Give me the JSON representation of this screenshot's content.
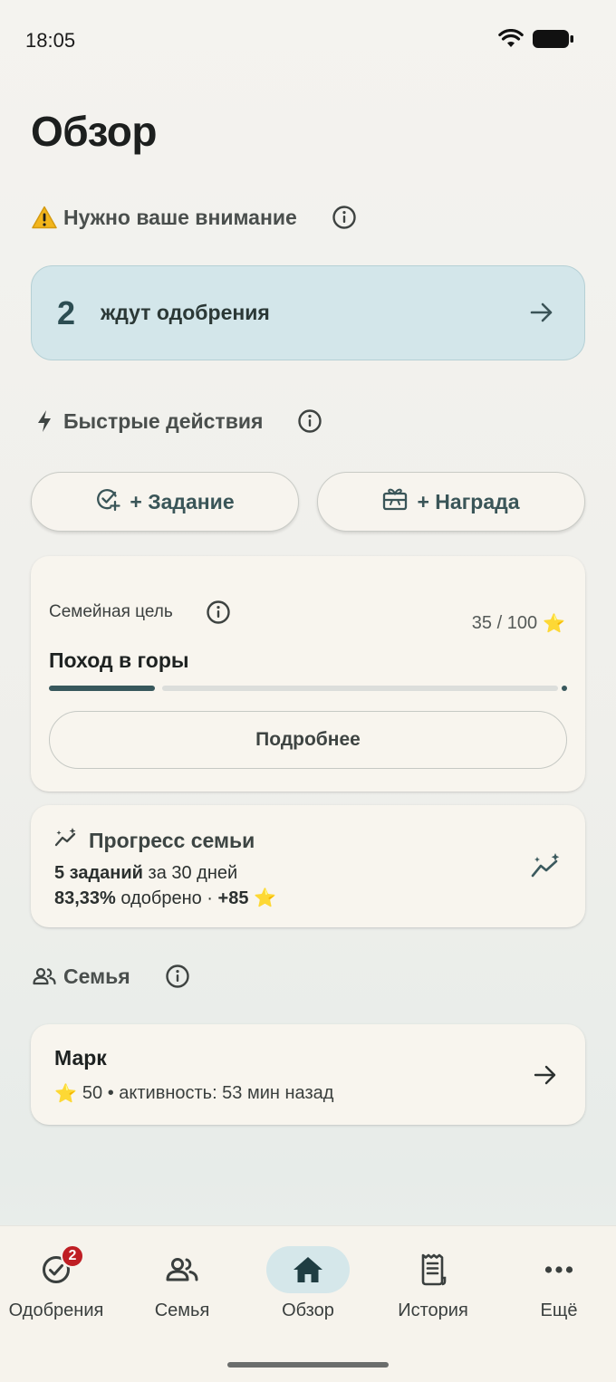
{
  "status_bar": {
    "time": "18:05"
  },
  "page": {
    "title": "Обзор"
  },
  "attention": {
    "title": "Нужно ваше внимание",
    "pending_count": "2",
    "pending_label": "ждут одобрения"
  },
  "quick_actions": {
    "title": "Быстрые действия",
    "add_task": "+ Задание",
    "add_reward": "+ Награда"
  },
  "goal": {
    "label": "Семейная цель",
    "stars": "35 / 100",
    "star_emoji": "⭐",
    "name": "Поход в горы",
    "progress": 0.35,
    "details_button": "Подробнее"
  },
  "family_progress": {
    "title": "Прогресс семьи",
    "tasks_count": "5 заданий",
    "tasks_period": " за 30 дней",
    "approved_pct": "83,33%",
    "approved_text": " одобрено · ",
    "stars_gain": "+85",
    "star_emoji": "⭐"
  },
  "family": {
    "title": "Семья",
    "members": [
      {
        "name": "Марк",
        "star_emoji": "⭐",
        "meta": "50 • активность: 53 мин назад"
      }
    ]
  },
  "nav": {
    "items": [
      {
        "label": "Одобрения",
        "badge": "2"
      },
      {
        "label": "Семья"
      },
      {
        "label": "Обзор"
      },
      {
        "label": "История"
      },
      {
        "label": "Ещё"
      }
    ],
    "active_index": 2
  },
  "colors": {
    "accent": "#38585c",
    "attention_bg": "#d3e6ea",
    "badge": "#bf1e24",
    "card_bg": "#f8f5ee"
  }
}
